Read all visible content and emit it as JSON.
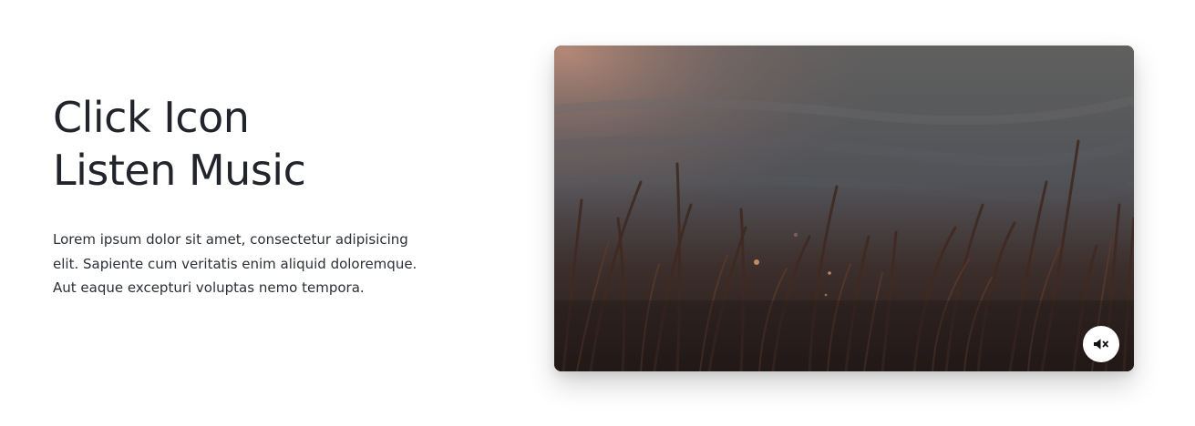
{
  "hero": {
    "title_line_1": "Click Icon",
    "title_line_2": "Listen Music",
    "description": "Lorem ipsum dolor sit amet, consectetur adipisicing elit. Sapiente cum veritatis enim aliquid doloremque. Aut eaque excepturi voluptas nemo tempora."
  },
  "video": {
    "scene": "grass-field-dusk",
    "mute_icon": "volume-mute-icon",
    "muted": true
  },
  "colors": {
    "text": "#21252b",
    "background": "#ffffff",
    "button_bg": "#ffffff"
  }
}
